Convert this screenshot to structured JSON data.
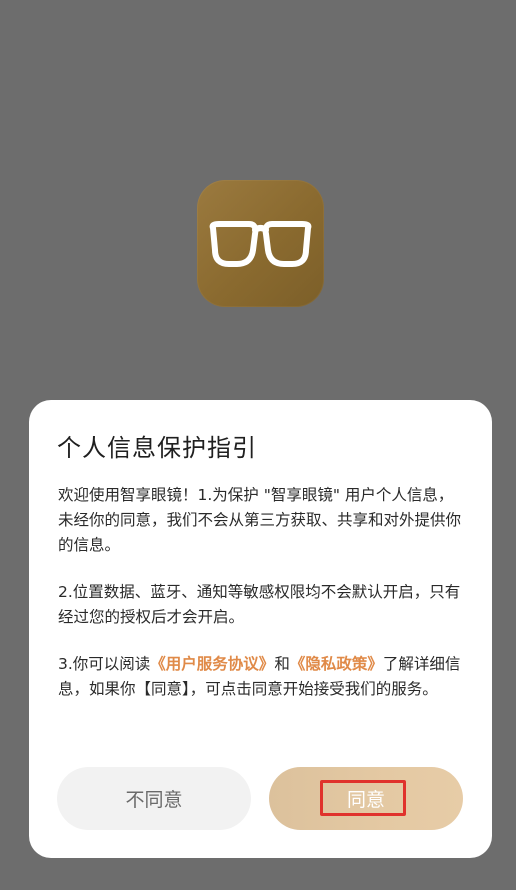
{
  "app": {
    "icon_name": "glasses-icon"
  },
  "dialog": {
    "title": "个人信息保护指引",
    "paragraph1": "欢迎使用智享眼镜！1.为保护 \"智享眼镜\" 用户个人信息，未经你的同意，我们不会从第三方获取、共享和对外提供你的信息。",
    "paragraph2": "2.位置数据、蓝牙、通知等敏感权限均不会默认开启，只有经过您的授权后才会开启。",
    "paragraph3_prefix": "3.你可以阅读",
    "user_agreement_link": "《用户服务协议》",
    "paragraph3_and": "和",
    "privacy_policy_link": "《隐私政策》",
    "paragraph3_suffix": "了解详细信息，如果你【同意】，可点击同意开始接受我们的服务。",
    "disagree_label": "不同意",
    "agree_label": "同意"
  },
  "colors": {
    "overlay": "#6d6d6d",
    "link": "#e08a48",
    "agree_button": "#e0c59f",
    "disagree_button": "#f2f2f2",
    "highlight": "#e0322c"
  }
}
